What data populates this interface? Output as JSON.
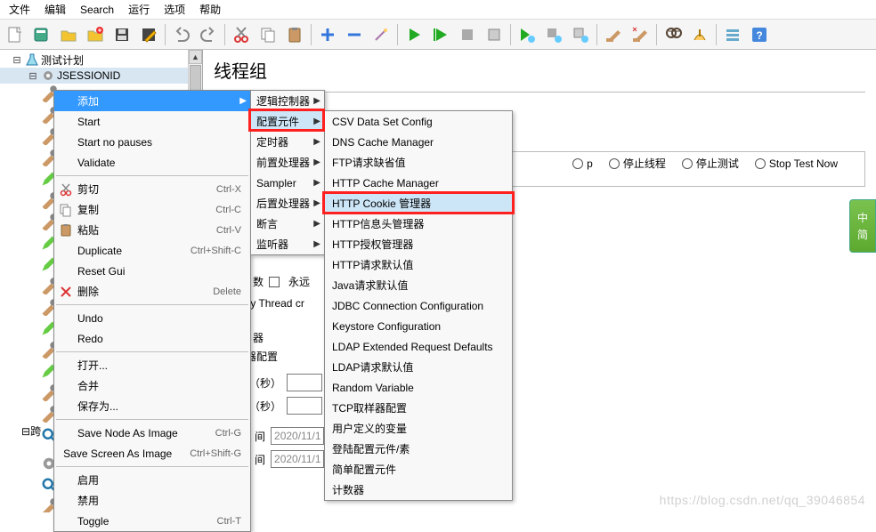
{
  "menubar": [
    "文件",
    "编辑",
    "Search",
    "运行",
    "选项",
    "帮助"
  ],
  "toolbar_icons": [
    "new-file",
    "open-templates",
    "open",
    "close",
    "save",
    "save-as",
    "",
    "undo",
    "redo",
    "",
    "cut",
    "copy",
    "paste",
    "",
    "add",
    "remove",
    "wand",
    "",
    "start",
    "start-no-pause",
    "stop",
    "shutdown",
    "",
    "start-remote",
    "stop-remote",
    "shutdown-remote",
    "",
    "clear",
    "clear-all",
    "",
    "search",
    "reset-search",
    "",
    "toggle",
    "help"
  ],
  "tree": {
    "plan": "测试计划",
    "node1": "JSESSIONID",
    "cross": "跨"
  },
  "editor": {
    "title": "线程组",
    "loop_prefix": "数",
    "forever": "永远",
    "delay_thread": "lay Thread cr",
    "scheduler_prefix": "器",
    "scheduler_group": "器配置",
    "duration_label": "间（秒）",
    "startup_label": "迟（秒）",
    "start_time_label": "间",
    "end_time_label": "间",
    "time_a": "2020/11/1",
    "time_b": "2020/11/1",
    "radios": {
      "continue_suffix": "p",
      "stop_thread": "停止线程",
      "stop_test": "停止测试",
      "stop_now": "Stop Test Now"
    }
  },
  "ctx_main": {
    "add": "添加",
    "items": [
      {
        "label": "Start"
      },
      {
        "label": "Start no pauses"
      },
      {
        "label": "Validate"
      },
      {
        "sep": true
      },
      {
        "label": "剪切",
        "sc": "Ctrl-X",
        "icon": "cut"
      },
      {
        "label": "复制",
        "sc": "Ctrl-C",
        "icon": "copy"
      },
      {
        "label": "粘贴",
        "sc": "Ctrl-V",
        "icon": "paste"
      },
      {
        "label": "Duplicate",
        "sc": "Ctrl+Shift-C"
      },
      {
        "label": "Reset Gui"
      },
      {
        "label": "删除",
        "sc": "Delete",
        "icon": "delete"
      },
      {
        "sep": true
      },
      {
        "label": "Undo"
      },
      {
        "label": "Redo"
      },
      {
        "sep": true
      },
      {
        "label": "打开..."
      },
      {
        "label": "合并"
      },
      {
        "label": "保存为..."
      },
      {
        "sep": true
      },
      {
        "label": "Save Node As Image",
        "sc": "Ctrl-G"
      },
      {
        "label": "Save Screen As Image",
        "sc": "Ctrl+Shift-G"
      },
      {
        "sep": true
      },
      {
        "label": "启用"
      },
      {
        "label": "禁用"
      },
      {
        "label": "Toggle",
        "sc": "Ctrl-T"
      }
    ]
  },
  "ctx_sub": [
    {
      "label": "逻辑控制器"
    },
    {
      "label": "配置元件",
      "mark": true
    },
    {
      "label": "定时器"
    },
    {
      "label": "前置处理器"
    },
    {
      "label": "Sampler"
    },
    {
      "label": "后置处理器"
    },
    {
      "label": "断言"
    },
    {
      "label": "监听器"
    }
  ],
  "ctx_config": [
    "CSV Data Set Config",
    "DNS Cache Manager",
    "FTP请求缺省值",
    "HTTP Cache Manager",
    "HTTP Cookie 管理器",
    "HTTP信息头管理器",
    "HTTP授权管理器",
    "HTTP请求默认值",
    "Java请求默认值",
    "JDBC Connection Configuration",
    "Keystore Configuration",
    "LDAP Extended Request Defaults",
    "LDAP请求默认值",
    "Random Variable",
    "TCP取样器配置",
    "用户定义的变量",
    "登陆配置元件/素",
    "简单配置元件",
    "计数器"
  ],
  "side_tab": {
    "a": "中",
    "b": "简"
  },
  "watermark": "https://blog.csdn.net/qq_39046854"
}
